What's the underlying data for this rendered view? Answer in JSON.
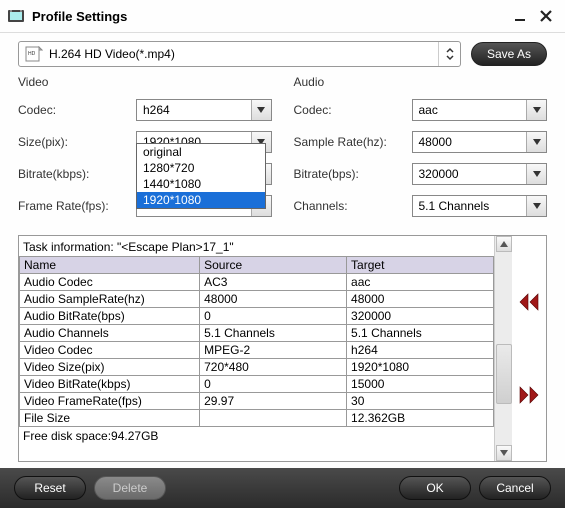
{
  "window": {
    "title": "Profile Settings"
  },
  "profile": {
    "selected": "H.264 HD Video(*.mp4)",
    "saveas": "Save As"
  },
  "video": {
    "title": "Video",
    "codec_label": "Codec:",
    "codec_value": "h264",
    "size_label": "Size(pix):",
    "size_value": "1920*1080",
    "size_options": [
      "original",
      "1280*720",
      "1440*1080",
      "1920*1080"
    ],
    "bitrate_label": "Bitrate(kbps):",
    "bitrate_value": "",
    "fps_label": "Frame Rate(fps):",
    "fps_value": ""
  },
  "audio": {
    "title": "Audio",
    "codec_label": "Codec:",
    "codec_value": "aac",
    "sr_label": "Sample Rate(hz):",
    "sr_value": "48000",
    "bitrate_label": "Bitrate(bps):",
    "bitrate_value": "320000",
    "channels_label": "Channels:",
    "channels_value": "5.1 Channels"
  },
  "table": {
    "task_info": "Task information: \"<Escape Plan>17_1\"",
    "headers": [
      "Name",
      "Source",
      "Target"
    ],
    "rows": [
      [
        "Audio Codec",
        "AC3",
        "aac"
      ],
      [
        "Audio SampleRate(hz)",
        "48000",
        "48000"
      ],
      [
        "Audio BitRate(bps)",
        "0",
        "320000"
      ],
      [
        "Audio Channels",
        "5.1 Channels",
        "5.1 Channels"
      ],
      [
        "Video Codec",
        "MPEG-2",
        "h264"
      ],
      [
        "Video Size(pix)",
        "720*480",
        "1920*1080"
      ],
      [
        "Video BitRate(kbps)",
        "0",
        "15000"
      ],
      [
        "Video FrameRate(fps)",
        "29.97",
        "30"
      ],
      [
        "File Size",
        "",
        "12.362GB"
      ]
    ],
    "free_space": "Free disk space:94.27GB"
  },
  "buttons": {
    "reset": "Reset",
    "delete": "Delete",
    "ok": "OK",
    "cancel": "Cancel"
  }
}
